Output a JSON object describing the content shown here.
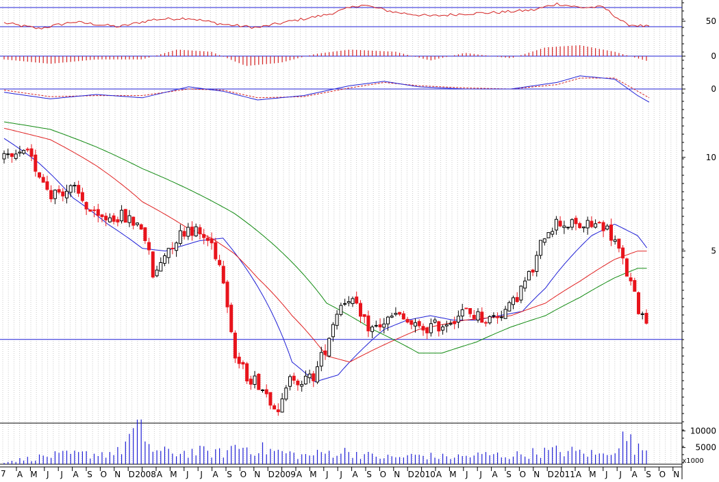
{
  "chart_data": {
    "type": "candlestick",
    "log_scale": true,
    "grid": "vertical dotted",
    "colors": {
      "up_candle": "#000000",
      "down_candle": "#e8141c",
      "ma_short": "#1f1fd6",
      "ma_mid": "#e02020",
      "ma_long": "#108a10",
      "reference_line": "#1f1fd6",
      "rsi_line": "#d42020",
      "histogram": "#d42020",
      "macd_line": "#1f1fd6",
      "signal_line": "#d42020",
      "volume": "#1f1fd6"
    },
    "x_axis": {
      "labels": [
        "A",
        "M",
        "J",
        "J",
        "A",
        "S",
        "O",
        "N",
        "D",
        "2008",
        "A",
        "M",
        "J",
        "J",
        "A",
        "S",
        "O",
        "N",
        "D",
        "2009",
        "A",
        "M",
        "J",
        "J",
        "A",
        "S",
        "O",
        "N",
        "D",
        "2010",
        "A",
        "M",
        "J",
        "J",
        "A",
        "S",
        "O",
        "N",
        "D",
        "2011",
        "A",
        "M",
        "J",
        "J",
        "A",
        "S",
        "O",
        "N"
      ],
      "first_label_fragment": "7"
    },
    "price_axis": {
      "ticks": [
        10,
        5
      ],
      "range": [
        1.4,
        13
      ]
    },
    "reference_level": 2.6,
    "price_series": [
      {
        "t": 0,
        "close": 9.8
      },
      {
        "t": 2,
        "close": 10.2
      },
      {
        "t": 4,
        "close": 7.7
      },
      {
        "t": 6,
        "close": 7.9
      },
      {
        "t": 8,
        "close": 6.3
      },
      {
        "t": 10,
        "close": 6.5
      },
      {
        "t": 12,
        "close": 6.0
      },
      {
        "t": 13,
        "close": 4.0
      },
      {
        "t": 14,
        "close": 5.0
      },
      {
        "t": 16,
        "close": 6.0
      },
      {
        "t": 18,
        "close": 5.3
      },
      {
        "t": 19,
        "close": 4.2
      },
      {
        "t": 20,
        "close": 2.3
      },
      {
        "t": 21,
        "close": 2.0
      },
      {
        "t": 22,
        "close": 1.9
      },
      {
        "t": 23,
        "close": 1.7
      },
      {
        "t": 24,
        "close": 1.55
      },
      {
        "t": 25,
        "close": 2.0
      },
      {
        "t": 26,
        "close": 1.9
      },
      {
        "t": 27,
        "close": 2.0
      },
      {
        "t": 28,
        "close": 2.5
      },
      {
        "t": 29,
        "close": 3.3
      },
      {
        "t": 30,
        "close": 3.6
      },
      {
        "t": 31,
        "close": 3.0
      },
      {
        "t": 32,
        "close": 2.8
      },
      {
        "t": 34,
        "close": 3.1
      },
      {
        "t": 36,
        "close": 2.8
      },
      {
        "t": 38,
        "close": 2.9
      },
      {
        "t": 40,
        "close": 3.2
      },
      {
        "t": 42,
        "close": 3.0
      },
      {
        "t": 44,
        "close": 3.3
      },
      {
        "t": 46,
        "close": 4.4
      },
      {
        "t": 47,
        "close": 5.8
      },
      {
        "t": 48,
        "close": 6.2
      },
      {
        "t": 50,
        "close": 6.0
      },
      {
        "t": 52,
        "close": 6.1
      },
      {
        "t": 53,
        "close": 5.4
      },
      {
        "t": 54,
        "close": 4.3
      },
      {
        "t": 55,
        "close": 3.3
      },
      {
        "t": 56,
        "close": 2.9
      }
    ],
    "series": [
      {
        "name": "ma_short",
        "values": [
          {
            "t": 0,
            "v": 11.5
          },
          {
            "t": 3,
            "v": 9.6
          },
          {
            "t": 6,
            "v": 7.4
          },
          {
            "t": 9,
            "v": 6.1
          },
          {
            "t": 12,
            "v": 5.1
          },
          {
            "t": 14,
            "v": 5.0
          },
          {
            "t": 17,
            "v": 5.4
          },
          {
            "t": 19,
            "v": 5.5
          },
          {
            "t": 21,
            "v": 4.4
          },
          {
            "t": 23,
            "v": 3.3
          },
          {
            "t": 25,
            "v": 2.2
          },
          {
            "t": 27,
            "v": 1.9
          },
          {
            "t": 29,
            "v": 2.0
          },
          {
            "t": 31,
            "v": 2.4
          },
          {
            "t": 33,
            "v": 2.8
          },
          {
            "t": 35,
            "v": 3.0
          },
          {
            "t": 37,
            "v": 3.1
          },
          {
            "t": 39,
            "v": 3.0
          },
          {
            "t": 41,
            "v": 3.0
          },
          {
            "t": 43,
            "v": 3.1
          },
          {
            "t": 45,
            "v": 3.2
          },
          {
            "t": 47,
            "v": 3.8
          },
          {
            "t": 49,
            "v": 4.7
          },
          {
            "t": 51,
            "v": 5.6
          },
          {
            "t": 53,
            "v": 6.1
          },
          {
            "t": 55,
            "v": 5.6
          },
          {
            "t": 56,
            "v": 5.0
          }
        ]
      },
      {
        "name": "ma_mid",
        "values": [
          {
            "t": 0,
            "v": 12.4
          },
          {
            "t": 4,
            "v": 11.4
          },
          {
            "t": 8,
            "v": 9.4
          },
          {
            "t": 12,
            "v": 7.2
          },
          {
            "t": 16,
            "v": 5.9
          },
          {
            "t": 18,
            "v": 5.5
          },
          {
            "t": 20,
            "v": 4.9
          },
          {
            "t": 22,
            "v": 4.1
          },
          {
            "t": 25,
            "v": 3.1
          },
          {
            "t": 28,
            "v": 2.3
          },
          {
            "t": 30,
            "v": 2.2
          },
          {
            "t": 33,
            "v": 2.5
          },
          {
            "t": 36,
            "v": 2.8
          },
          {
            "t": 40,
            "v": 3.0
          },
          {
            "t": 44,
            "v": 3.1
          },
          {
            "t": 47,
            "v": 3.4
          },
          {
            "t": 50,
            "v": 4.0
          },
          {
            "t": 53,
            "v": 4.7
          },
          {
            "t": 55,
            "v": 5.0
          },
          {
            "t": 56,
            "v": 5.0
          }
        ]
      },
      {
        "name": "ma_long",
        "values": [
          {
            "t": 0,
            "v": 13.0
          },
          {
            "t": 4,
            "v": 12.3
          },
          {
            "t": 8,
            "v": 10.8
          },
          {
            "t": 12,
            "v": 9.2
          },
          {
            "t": 16,
            "v": 7.9
          },
          {
            "t": 20,
            "v": 6.6
          },
          {
            "t": 24,
            "v": 5.0
          },
          {
            "t": 28,
            "v": 3.4
          },
          {
            "t": 32,
            "v": 2.8
          },
          {
            "t": 36,
            "v": 2.35
          },
          {
            "t": 38,
            "v": 2.35
          },
          {
            "t": 41,
            "v": 2.55
          },
          {
            "t": 44,
            "v": 2.85
          },
          {
            "t": 47,
            "v": 3.1
          },
          {
            "t": 50,
            "v": 3.55
          },
          {
            "t": 53,
            "v": 4.1
          },
          {
            "t": 55,
            "v": 4.4
          },
          {
            "t": 56,
            "v": 4.4
          }
        ]
      }
    ],
    "rsi_panel": {
      "ticks": [
        50
      ],
      "levels": [
        70,
        30
      ],
      "values": [
        {
          "t": 0,
          "v": 38
        },
        {
          "t": 3,
          "v": 26
        },
        {
          "t": 6,
          "v": 40
        },
        {
          "t": 10,
          "v": 30
        },
        {
          "t": 13,
          "v": 45
        },
        {
          "t": 16,
          "v": 48
        },
        {
          "t": 19,
          "v": 35
        },
        {
          "t": 22,
          "v": 28
        },
        {
          "t": 25,
          "v": 42
        },
        {
          "t": 28,
          "v": 55
        },
        {
          "t": 31,
          "v": 76
        },
        {
          "t": 34,
          "v": 60
        },
        {
          "t": 37,
          "v": 52
        },
        {
          "t": 40,
          "v": 57
        },
        {
          "t": 43,
          "v": 60
        },
        {
          "t": 46,
          "v": 65
        },
        {
          "t": 48,
          "v": 78
        },
        {
          "t": 50,
          "v": 70
        },
        {
          "t": 52,
          "v": 71
        },
        {
          "t": 54,
          "v": 35
        },
        {
          "t": 56,
          "v": 30
        }
      ]
    },
    "histogram_panel": {
      "ticks": [
        0
      ],
      "values": [
        {
          "t": 0,
          "v": -0.3
        },
        {
          "t": 4,
          "v": -0.7
        },
        {
          "t": 8,
          "v": -0.3
        },
        {
          "t": 12,
          "v": -0.3
        },
        {
          "t": 15,
          "v": 0.6
        },
        {
          "t": 18,
          "v": 0.4
        },
        {
          "t": 21,
          "v": -0.9
        },
        {
          "t": 24,
          "v": -0.6
        },
        {
          "t": 27,
          "v": 0.2
        },
        {
          "t": 30,
          "v": 0.6
        },
        {
          "t": 34,
          "v": 0.4
        },
        {
          "t": 37,
          "v": -0.4
        },
        {
          "t": 40,
          "v": 0.3
        },
        {
          "t": 44,
          "v": -0.2
        },
        {
          "t": 47,
          "v": 0.8
        },
        {
          "t": 50,
          "v": 1.0
        },
        {
          "t": 53,
          "v": 0.4
        },
        {
          "t": 56,
          "v": -0.5
        }
      ]
    },
    "macd_panel": {
      "ticks": [
        0
      ],
      "macd": [
        {
          "t": 0,
          "v": -0.3
        },
        {
          "t": 4,
          "v": -0.9
        },
        {
          "t": 8,
          "v": -0.5
        },
        {
          "t": 12,
          "v": -0.8
        },
        {
          "t": 16,
          "v": 0.2
        },
        {
          "t": 19,
          "v": -0.2
        },
        {
          "t": 22,
          "v": -1.0
        },
        {
          "t": 26,
          "v": -0.6
        },
        {
          "t": 30,
          "v": 0.3
        },
        {
          "t": 33,
          "v": 0.7
        },
        {
          "t": 36,
          "v": 0.2
        },
        {
          "t": 40,
          "v": 0.0
        },
        {
          "t": 44,
          "v": 0.0
        },
        {
          "t": 48,
          "v": 0.6
        },
        {
          "t": 50,
          "v": 1.2
        },
        {
          "t": 53,
          "v": 0.9
        },
        {
          "t": 55,
          "v": -0.6
        },
        {
          "t": 56,
          "v": -1.2
        }
      ],
      "signal": [
        {
          "t": 0,
          "v": -0.1
        },
        {
          "t": 4,
          "v": -0.7
        },
        {
          "t": 8,
          "v": -0.6
        },
        {
          "t": 12,
          "v": -0.6
        },
        {
          "t": 16,
          "v": 0.0
        },
        {
          "t": 19,
          "v": -0.1
        },
        {
          "t": 22,
          "v": -0.8
        },
        {
          "t": 26,
          "v": -0.7
        },
        {
          "t": 30,
          "v": 0.1
        },
        {
          "t": 33,
          "v": 0.6
        },
        {
          "t": 36,
          "v": 0.3
        },
        {
          "t": 40,
          "v": 0.1
        },
        {
          "t": 44,
          "v": 0.0
        },
        {
          "t": 48,
          "v": 0.4
        },
        {
          "t": 50,
          "v": 1.0
        },
        {
          "t": 53,
          "v": 1.0
        },
        {
          "t": 55,
          "v": -0.2
        },
        {
          "t": 56,
          "v": -0.8
        }
      ]
    },
    "volume_panel": {
      "ticks": [
        10000,
        5000
      ],
      "unit_label": "x1000",
      "values": [
        {
          "t": 0,
          "v": 800
        },
        {
          "t": 2,
          "v": 1800
        },
        {
          "t": 4,
          "v": 2800
        },
        {
          "t": 6,
          "v": 3200
        },
        {
          "t": 8,
          "v": 3500
        },
        {
          "t": 10,
          "v": 4000
        },
        {
          "t": 11,
          "v": 9700
        },
        {
          "t": 12,
          "v": 10800
        },
        {
          "t": 13,
          "v": 4200
        },
        {
          "t": 15,
          "v": 3800
        },
        {
          "t": 17,
          "v": 4200
        },
        {
          "t": 19,
          "v": 3600
        },
        {
          "t": 20,
          "v": 6000
        },
        {
          "t": 22,
          "v": 5200
        },
        {
          "t": 24,
          "v": 4000
        },
        {
          "t": 26,
          "v": 2800
        },
        {
          "t": 28,
          "v": 3800
        },
        {
          "t": 30,
          "v": 4200
        },
        {
          "t": 32,
          "v": 2600
        },
        {
          "t": 34,
          "v": 2200
        },
        {
          "t": 36,
          "v": 3000
        },
        {
          "t": 38,
          "v": 2400
        },
        {
          "t": 40,
          "v": 2600
        },
        {
          "t": 42,
          "v": 3200
        },
        {
          "t": 44,
          "v": 2800
        },
        {
          "t": 46,
          "v": 3800
        },
        {
          "t": 48,
          "v": 4400
        },
        {
          "t": 50,
          "v": 4000
        },
        {
          "t": 52,
          "v": 3000
        },
        {
          "t": 54,
          "v": 9000
        },
        {
          "t": 55,
          "v": 4800
        },
        {
          "t": 56,
          "v": 5200
        }
      ]
    }
  }
}
